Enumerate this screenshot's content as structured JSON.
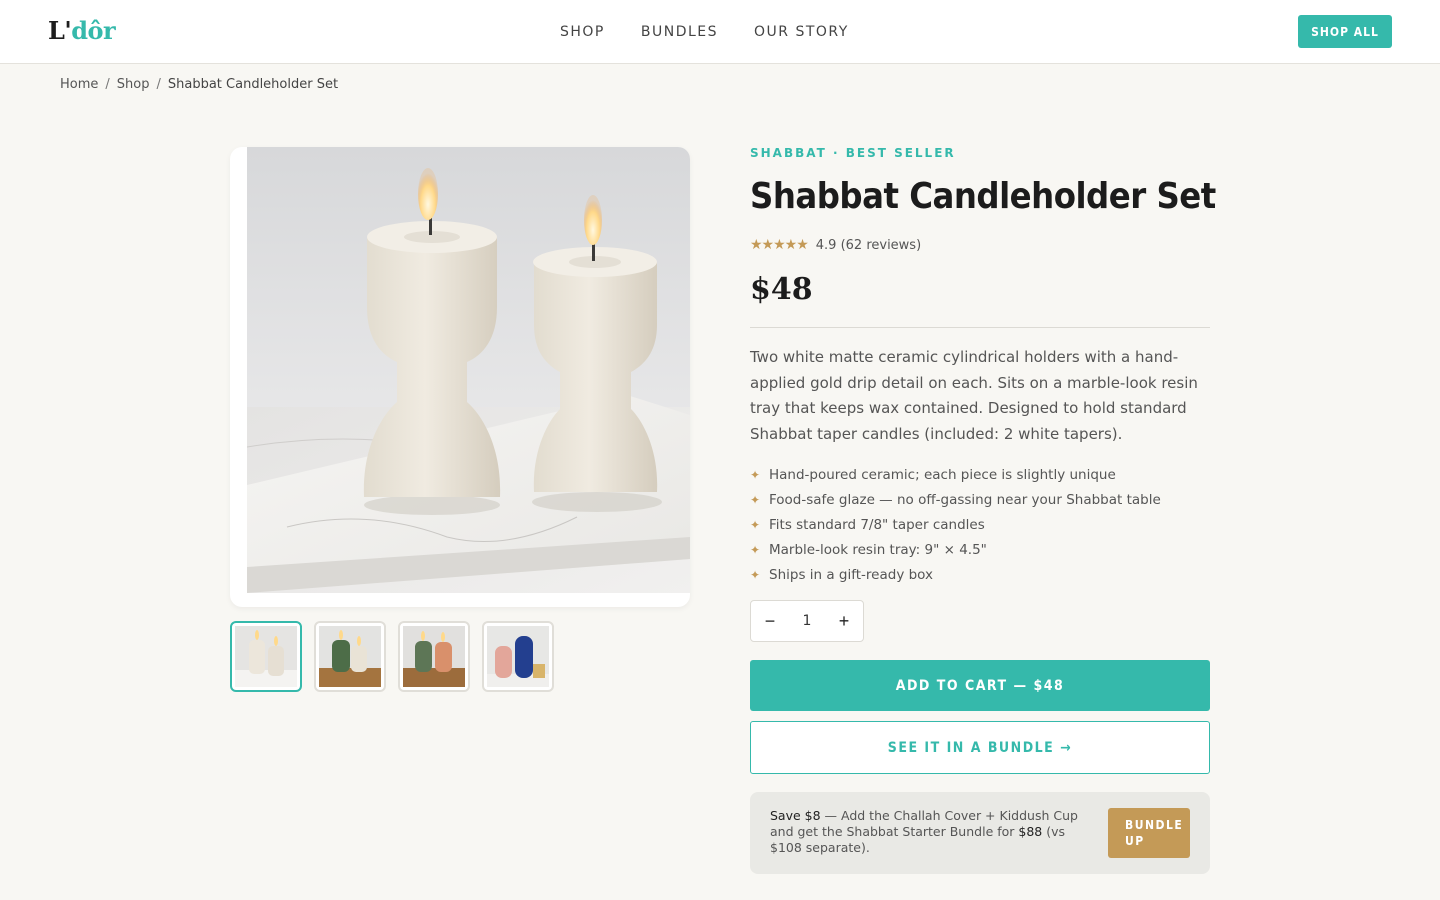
{
  "header": {
    "logo_prefix": "L'",
    "logo_accent": "dôr",
    "nav": [
      "SHOP",
      "BUNDLES",
      "OUR STORY"
    ],
    "cta_label": "SHOP ALL"
  },
  "breadcrumb": {
    "items": [
      "Home",
      "Shop",
      "Shabbat Candleholder Set"
    ],
    "separator": "/"
  },
  "gallery": {
    "thumbnails": [
      {
        "name": "white-ceramic-on-marble",
        "active": true
      },
      {
        "name": "green-ceramic-on-wood",
        "active": false
      },
      {
        "name": "green-terracotta-on-wood",
        "active": false
      },
      {
        "name": "pink-blue-ceramic",
        "active": false
      }
    ]
  },
  "product": {
    "eyebrow": "SHABBAT · BEST SELLER",
    "title": "Shabbat Candleholder Set",
    "stars": "★★★★★",
    "rating_text": "4.9 (62 reviews)",
    "price": "$48",
    "description": "Two white matte ceramic cylindrical holders with a hand-applied gold drip detail on each. Sits on a marble-look resin tray that keeps wax contained. Designed to hold standard Shabbat taper candles (included: 2 white tapers).",
    "features": [
      "Hand-poured ceramic; each piece is slightly unique",
      "Food-safe glaze — no off-gassing near your Shabbat table",
      "Fits standard 7/8\" taper candles",
      "Marble-look resin tray: 9\" × 4.5\"",
      "Ships in a gift-ready box"
    ],
    "feature_bullet": "✦",
    "quantity": "1",
    "minus": "−",
    "plus": "+",
    "add_to_cart_label": "ADD TO CART — $48",
    "bundle_button_label": "SEE IT IN A BUNDLE →"
  },
  "upsell": {
    "save_label": "Save $8",
    "text_middle": " — Add the Challah Cover + Kiddush Cup and get the Shabbat Starter Bundle for ",
    "bundle_price": "$88",
    "text_end": " (vs $108 separate).",
    "button_line1": "BUNDLE",
    "button_line2": "UP"
  },
  "colors": {
    "accent": "#35b9ab",
    "gold": "#c49a57",
    "background": "#f8f7f3"
  }
}
